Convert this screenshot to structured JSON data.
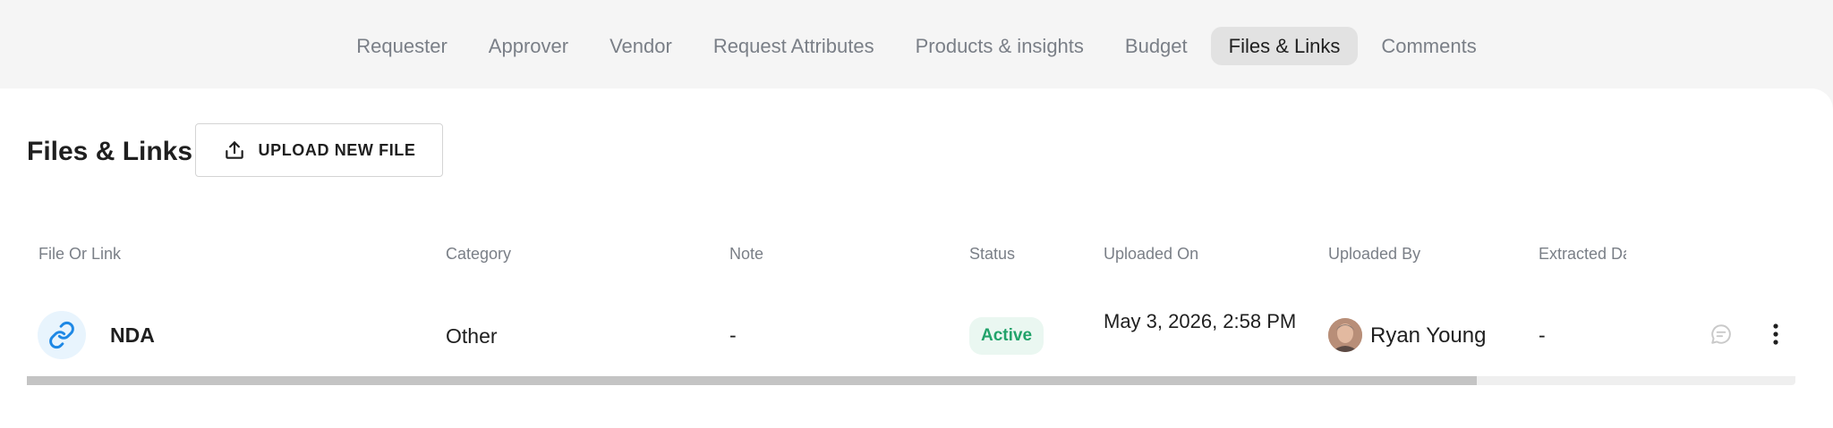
{
  "tabs": [
    {
      "label": "Requester",
      "active": false
    },
    {
      "label": "Approver",
      "active": false
    },
    {
      "label": "Vendor",
      "active": false
    },
    {
      "label": "Request Attributes",
      "active": false
    },
    {
      "label": "Products & insights",
      "active": false
    },
    {
      "label": "Budget",
      "active": false
    },
    {
      "label": "Files & Links",
      "active": true
    },
    {
      "label": "Comments",
      "active": false
    }
  ],
  "section": {
    "title": "Files & Links",
    "upload_label": "UPLOAD NEW FILE"
  },
  "table": {
    "columns": [
      "File Or Link",
      "Category",
      "Note",
      "Status",
      "Uploaded On",
      "Uploaded By",
      "Extracted Data"
    ],
    "rows": [
      {
        "file": "NDA",
        "file_icon": "link-icon",
        "category": "Other",
        "note": "-",
        "status": "Active",
        "uploaded_on": "May 3, 2026, 2:58 PM",
        "uploaded_by": "Ryan Young",
        "extracted": "-"
      }
    ],
    "scroll_fraction": 0.82
  },
  "colors": {
    "status_active_text": "#22a36b",
    "status_active_bg": "#eaf7f1",
    "link_icon": "#1e88e5"
  }
}
